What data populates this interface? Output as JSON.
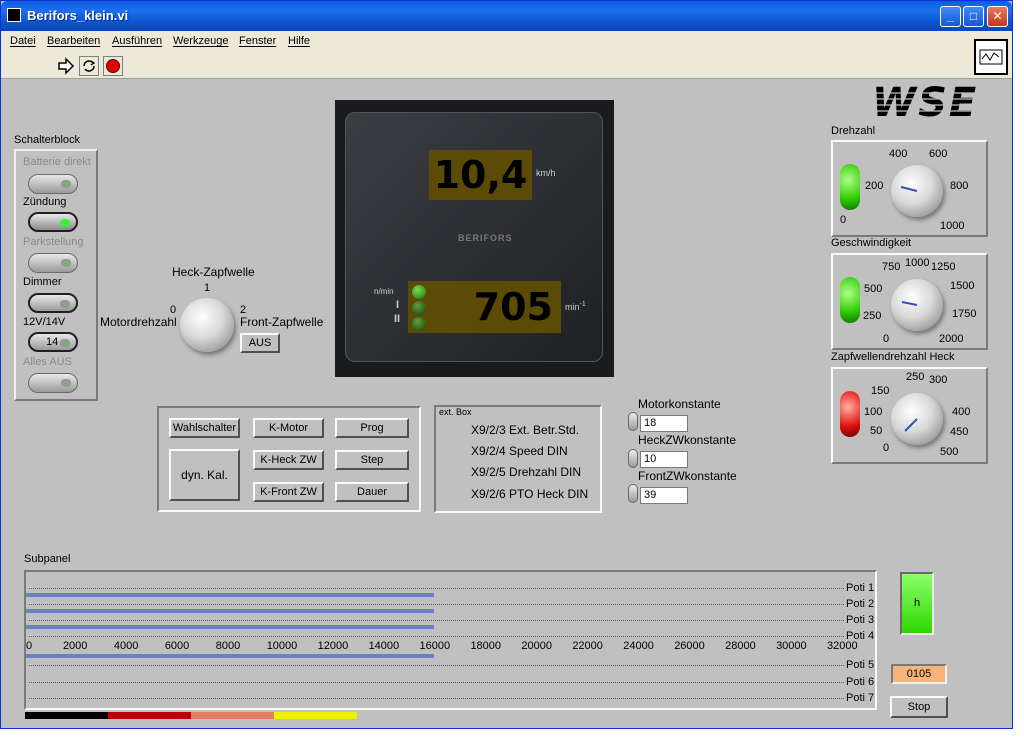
{
  "window": {
    "title": "Berifors_klein.vi"
  },
  "menu": [
    "Datei",
    "Bearbeiten",
    "Ausführen",
    "Werkzeuge",
    "Fenster",
    "Hilfe"
  ],
  "logo": "WSE",
  "schalterblock": {
    "title": "Schalterblock",
    "switches": [
      {
        "label": "Batterie direkt",
        "enabled": false,
        "on": false
      },
      {
        "label": "Zündung",
        "enabled": true,
        "on": true
      },
      {
        "label": "Parkstellung",
        "enabled": false,
        "on": false
      },
      {
        "label": "Dimmer",
        "enabled": true,
        "on": false
      },
      {
        "label": "12V/14V",
        "enabled": true,
        "on": false,
        "value": "14"
      },
      {
        "label": "Alles AUS",
        "enabled": false,
        "on": false
      }
    ]
  },
  "zapfwelle_knob": {
    "title": "Heck-Zapfwelle",
    "left_label": "Motordrehzahl",
    "right_label": "Front-Zapfwelle",
    "tick_0": "0",
    "tick_1": "1",
    "tick_2": "2",
    "button": "AUS"
  },
  "display": {
    "speed": "10,4",
    "speed_unit": "km/h",
    "brand": "BERIFORS",
    "rpm": "705",
    "rpm_unit": "min",
    "rpm_unit_exp": "-1",
    "row_label_1": "n/min",
    "row_label_2": "I",
    "row_label_3": "II"
  },
  "buttons": {
    "wahlschalter": "Wahlschalter",
    "k_motor": "K-Motor",
    "prog": "Prog",
    "dyn_kal": "dyn. Kal.",
    "k_heck_zw": "K-Heck ZW",
    "step": "Step",
    "k_front_zw": "K-Front ZW",
    "dauer": "Dauer"
  },
  "ext_box": {
    "title": "ext. Box",
    "lines": [
      "X9/2/3 Ext. Betr.Std.",
      "X9/2/4 Speed DIN",
      "X9/2/5 Drehzahl DIN",
      "X9/2/6 PTO Heck DIN"
    ]
  },
  "constants": {
    "motor": {
      "label": "Motorkonstante",
      "value": "18"
    },
    "heck": {
      "label": "HeckZWkonstante",
      "value": "10"
    },
    "front": {
      "label": "FrontZWkonstante",
      "value": "39"
    }
  },
  "gauges": {
    "drehzahl": {
      "title": "Drehzahl",
      "ticks": [
        "0",
        "200",
        "400",
        "600",
        "800",
        "1000"
      ],
      "led": "green"
    },
    "geschwindigkeit": {
      "title": "Geschwindigkeit",
      "ticks": [
        "0",
        "250",
        "500",
        "750",
        "1000",
        "1250",
        "1500",
        "1750",
        "2000"
      ],
      "led": "green"
    },
    "zapfwelle": {
      "title": "Zapfwellendrehzahl Heck",
      "ticks": [
        "0",
        "50",
        "100",
        "150",
        "250",
        "300",
        "400",
        "450",
        "500"
      ],
      "led": "red"
    }
  },
  "subpanel": {
    "title": "Subpanel",
    "rows": [
      "Poti 1",
      "Poti 2",
      "Poti 3",
      "Poti 4",
      "Poti 5",
      "Poti 6",
      "Poti 7"
    ],
    "scale": [
      "0",
      "2000",
      "4000",
      "6000",
      "8000",
      "10000",
      "12000",
      "14000",
      "16000",
      "18000",
      "20000",
      "22000",
      "24000",
      "26000",
      "28000",
      "30000",
      "32000"
    ],
    "bar_value": 16000
  },
  "indicator_h": "h",
  "counter": "0105",
  "stop_button": "Stop",
  "colors": {
    "strip": [
      "#000000",
      "#c00000",
      "#e08060",
      "#f0f000"
    ]
  }
}
